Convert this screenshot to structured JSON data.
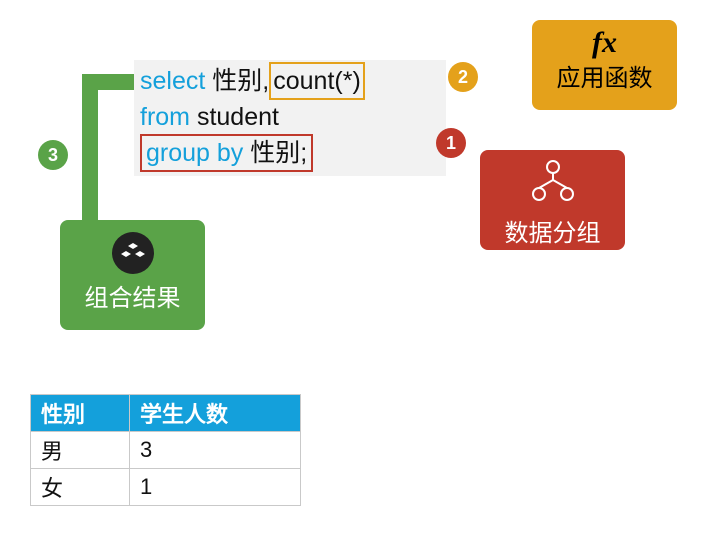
{
  "sql": {
    "kw_select": "select",
    "col_gender": "性别",
    "col_count": "count(*)",
    "kw_from": "from",
    "table": "student",
    "kw_group_by": "group by",
    "group_col": "性别",
    "terminator": ";"
  },
  "badges": {
    "one": "1",
    "two": "2",
    "three": "3"
  },
  "cards": {
    "function": {
      "fx": "fx",
      "label": "应用函数"
    },
    "grouping": {
      "label": "数据分组"
    },
    "combine": {
      "label": "组合结果"
    }
  },
  "table": {
    "headers": {
      "gender": "性别",
      "count": "学生人数"
    },
    "rows": [
      {
        "gender": "男",
        "count": "3"
      },
      {
        "gender": "女",
        "count": "1"
      }
    ]
  }
}
